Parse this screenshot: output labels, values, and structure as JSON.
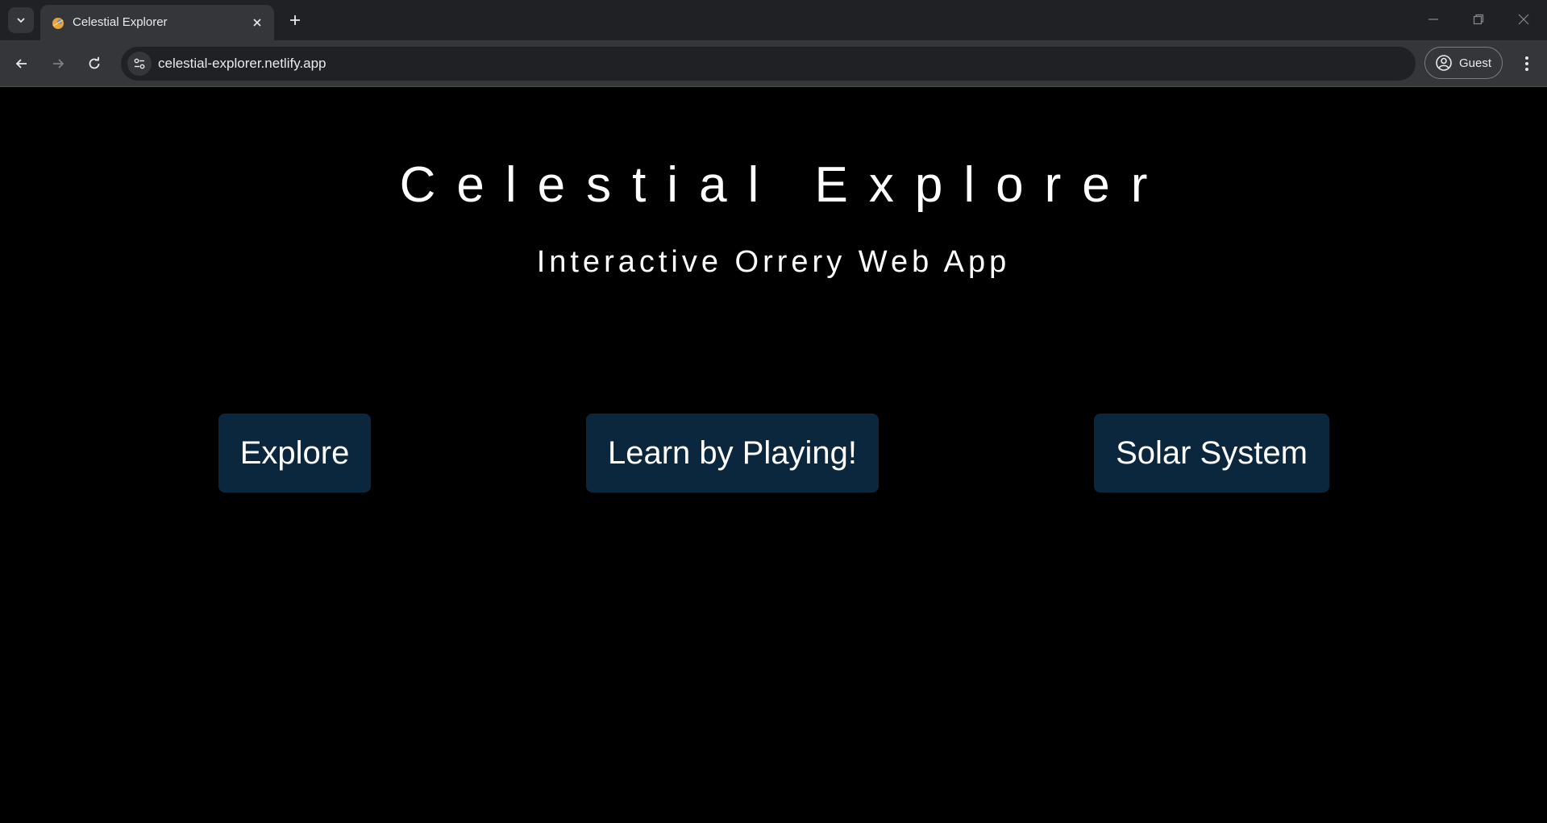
{
  "browser": {
    "tab": {
      "title": "Celestial Explorer"
    },
    "address_bar": {
      "url": "celestial-explorer.netlify.app"
    },
    "profile": {
      "label": "Guest"
    },
    "icons": {
      "tab_search": "chevron-down-icon",
      "favicon": "celestial-favicon",
      "tab_close": "close-icon",
      "new_tab": "plus-icon",
      "minimize": "minimize-icon",
      "restore": "restore-icon",
      "close": "close-icon",
      "back": "arrow-left-icon",
      "forward": "arrow-right-icon",
      "reload": "reload-icon",
      "site_info": "tune-icon",
      "profile": "account-circle-icon",
      "menu": "more-vert-icon"
    }
  },
  "page": {
    "title": "Celestial Explorer",
    "subtitle": "Interactive Orrery Web App",
    "buttons": [
      {
        "label": "Explore"
      },
      {
        "label": "Learn by Playing!"
      },
      {
        "label": "Solar System"
      }
    ]
  },
  "colors": {
    "page_background": "#000000",
    "button_background": "#0b273d",
    "text": "#ffffff",
    "browser_frame": "#202124",
    "browser_toolbar": "#35363a"
  }
}
